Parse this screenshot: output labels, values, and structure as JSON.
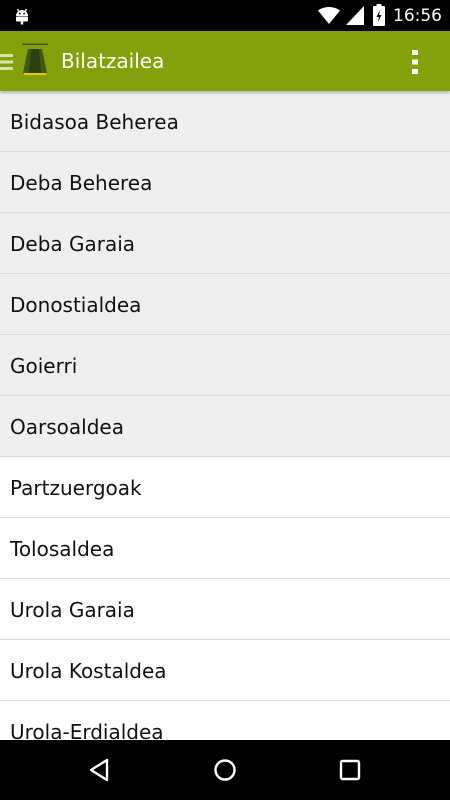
{
  "status_bar": {
    "time": "16:56",
    "icons": [
      "android-debug-icon",
      "wifi-icon",
      "signal-icon",
      "battery-icon"
    ]
  },
  "app_bar": {
    "title": "Bilatzailea",
    "color": "#84a00a",
    "icons": [
      "menu-icon",
      "app-logo-icon",
      "overflow-menu-icon"
    ]
  },
  "list": {
    "items": [
      {
        "label": "Bidasoa Beherea"
      },
      {
        "label": "Deba Beherea"
      },
      {
        "label": "Deba Garaia"
      },
      {
        "label": "Donostialdea"
      },
      {
        "label": "Goierri"
      },
      {
        "label": "Oarsoaldea"
      },
      {
        "label": "Partzuergoak"
      },
      {
        "label": "Tolosaldea"
      },
      {
        "label": "Urola Garaia"
      },
      {
        "label": "Urola Kostaldea"
      },
      {
        "label": "Urola-Erdialdea"
      }
    ]
  },
  "nav_bar": {
    "icons": [
      "back-icon",
      "home-icon",
      "recents-icon"
    ]
  }
}
